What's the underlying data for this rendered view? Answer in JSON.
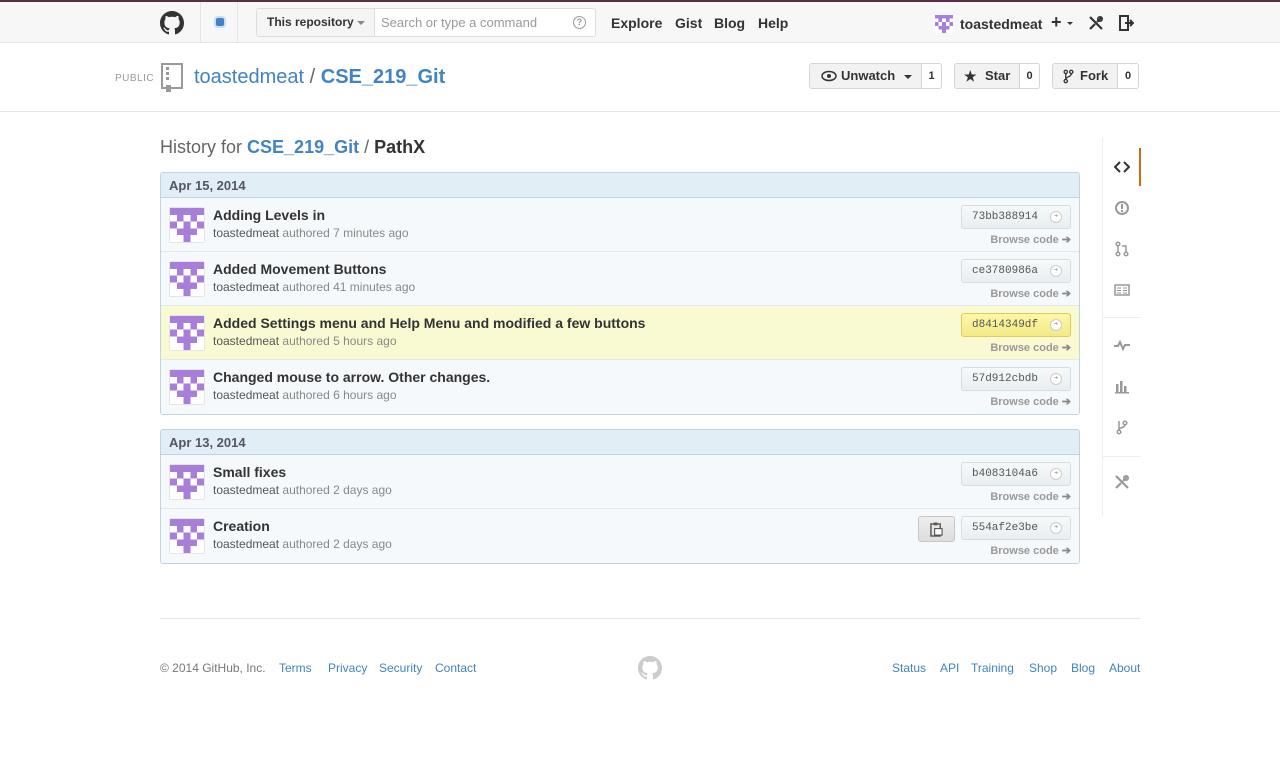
{
  "header": {
    "search_scope": "This repository",
    "search_placeholder": "Search or type a command",
    "help_symbol": "?",
    "nav": [
      "Explore",
      "Gist",
      "Blog",
      "Help"
    ],
    "username": "toastedmeat",
    "plus_label": "+"
  },
  "repo": {
    "visibility": "PUBLIC",
    "owner": "toastedmeat",
    "separator": "/",
    "name": "CSE_219_Git",
    "watch_label": "Unwatch",
    "watch_count": "1",
    "star_label": "Star",
    "star_count": "0",
    "fork_label": "Fork",
    "fork_count": "0"
  },
  "page": {
    "history_prefix": "History for",
    "repo_crumb": "CSE_219_Git",
    "separator": "/",
    "path": "PathX"
  },
  "commit_groups": [
    {
      "date": "Apr 15, 2014",
      "commits": [
        {
          "message": "Adding Levels in",
          "author": "toastedmeat",
          "authored": "authored",
          "time": "7 minutes ago",
          "sha": "73bb388914",
          "browse": "Browse code"
        },
        {
          "message": "Added Movement Buttons",
          "author": "toastedmeat",
          "authored": "authored",
          "time": "41 minutes ago",
          "sha": "ce3780986a",
          "browse": "Browse code"
        },
        {
          "message": "Added Settings menu and Help Menu and modified a few buttons",
          "author": "toastedmeat",
          "authored": "authored",
          "time": "5 hours ago",
          "sha": "d8414349df",
          "browse": "Browse code",
          "highlighted": true
        },
        {
          "message": "Changed mouse to arrow. Other changes.",
          "author": "toastedmeat",
          "authored": "authored",
          "time": "6 hours ago",
          "sha": "57d912cbdb",
          "browse": "Browse code"
        }
      ]
    },
    {
      "date": "Apr 13, 2014",
      "commits": [
        {
          "message": "Small fixes",
          "author": "toastedmeat",
          "authored": "authored",
          "time": "2 days ago",
          "sha": "b4083104a6",
          "browse": "Browse code"
        },
        {
          "message": "Creation",
          "author": "toastedmeat",
          "authored": "authored",
          "time": "2 days ago",
          "sha": "554af2e3be",
          "browse": "Browse code",
          "show_clipboard": true
        }
      ]
    }
  ],
  "sidebar": {
    "items": [
      "code-icon",
      "issues-icon",
      "pull-requests-icon",
      "wiki-icon",
      "pulse-icon",
      "graphs-icon",
      "network-icon",
      "settings-icon"
    ]
  },
  "footer": {
    "copyright": "© 2014 GitHub, Inc.",
    "left_links": [
      "Terms",
      "Privacy",
      "Security",
      "Contact"
    ],
    "right_links": [
      "Status",
      "API",
      "Training",
      "Shop",
      "Blog",
      "About"
    ]
  },
  "colors": {
    "link": "#4183c4",
    "highlight_row": "#fafad2",
    "group_header": "#e1eef5",
    "avatar": "#a87fd8",
    "sidebar_active": "#d26911"
  }
}
